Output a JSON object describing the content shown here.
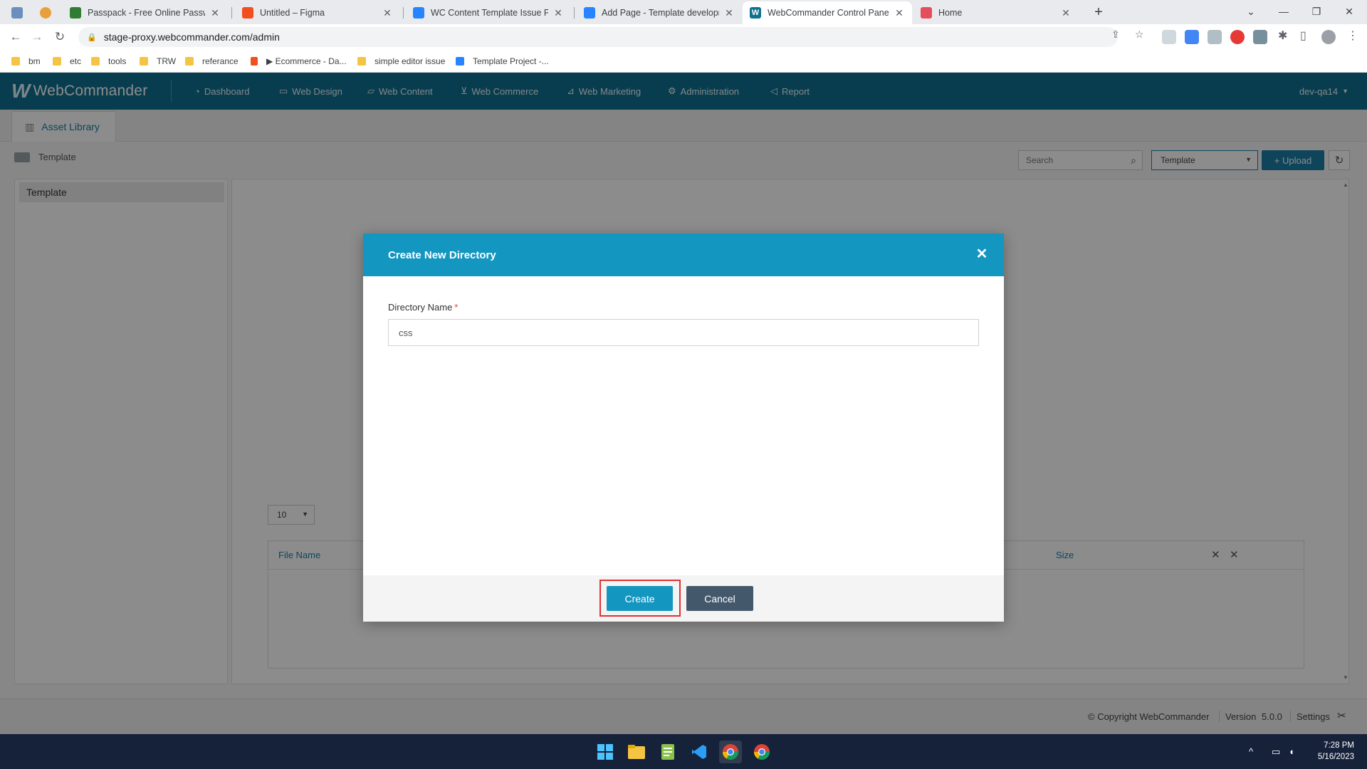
{
  "browser": {
    "tabs": [
      {
        "title": "",
        "favicon_color": "#6c8ebf"
      },
      {
        "title": "",
        "favicon_color": "#e8a13a"
      },
      {
        "title": "Passpack - Free Online Password",
        "favicon_color": "#2e7d32"
      },
      {
        "title": "Untitled – Figma",
        "favicon_color": "#f24e1e"
      },
      {
        "title": "WC Content Template Issue Fixin",
        "favicon_color": "#2684ff"
      },
      {
        "title": "Add Page - Template developme",
        "favicon_color": "#2684ff"
      },
      {
        "title": "WebCommander Control Panel",
        "favicon_color": "#0f7090",
        "active": true
      },
      {
        "title": "Home",
        "favicon_color": "#e44d5c"
      }
    ],
    "address": "stage-proxy.webcommander.com/admin",
    "bookmarks": [
      "bm",
      "etc",
      "tools",
      "TRW",
      "referance",
      "▶ Ecommerce - Da...",
      "simple editor issue",
      "Template Project -..."
    ]
  },
  "app": {
    "brand": "WebCommander",
    "nav": [
      "Dashboard",
      "Web Design",
      "Web Content",
      "Web Commerce",
      "Web Marketing",
      "Administration",
      "Report"
    ],
    "user": "dev-qa14",
    "subtab": "Asset Library",
    "breadcrumb": "Template",
    "search_placeholder": "Search",
    "filter_value": "Template",
    "upload_label": "+ Upload",
    "tree": [
      "Template"
    ],
    "per_page": "10",
    "table_headers": {
      "file_name": "File Name",
      "size": "Size"
    },
    "footer": {
      "copyright": "© Copyright WebCommander",
      "version_label": "Version",
      "version": "5.0.0",
      "settings": "Settings"
    }
  },
  "modal": {
    "title": "Create New Directory",
    "field_label": "Directory Name",
    "required_mark": "*",
    "field_value": "css",
    "create_label": "Create",
    "cancel_label": "Cancel"
  },
  "system": {
    "time": "7:28 PM",
    "date": "5/16/2023"
  },
  "colors": {
    "app_header": "#0f7090",
    "modal_header": "#1396c0",
    "primary_button": "#1396c0",
    "cancel_button": "#44586c",
    "highlight_border": "#e03131"
  }
}
